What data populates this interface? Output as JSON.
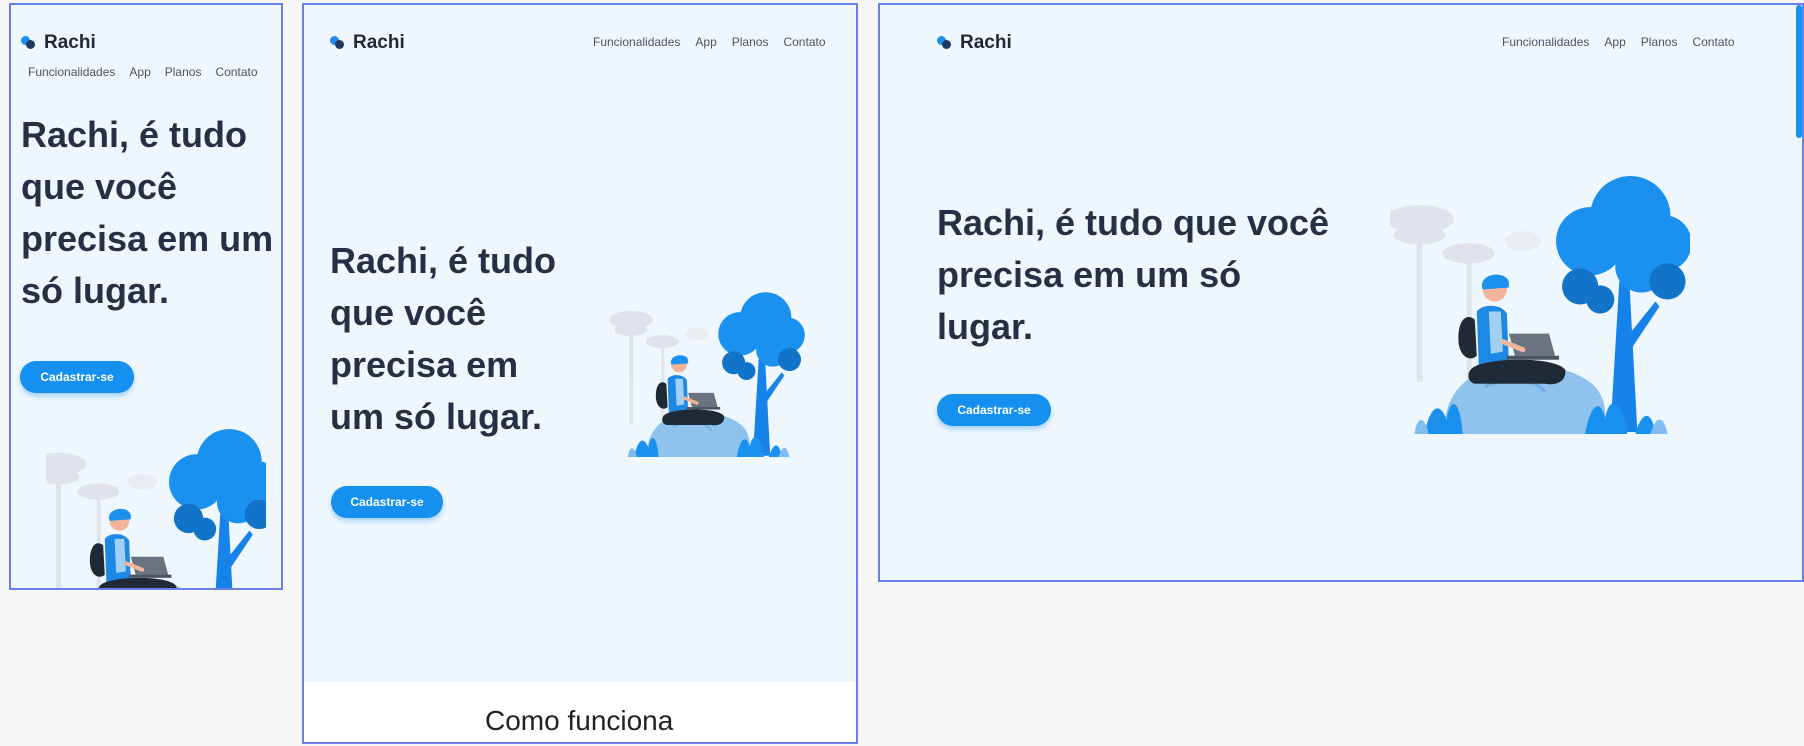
{
  "brand": {
    "name": "Rachi",
    "dot_color": "#1d8ef0",
    "dot_color_dark": "#1f3a5c"
  },
  "nav": {
    "items": [
      "Funcionalidades",
      "App",
      "Planos",
      "Contato"
    ]
  },
  "hero": {
    "title": "Rachi, é tudo que você precisa em um só lugar.",
    "title_lines_mobile": [
      "Rachi, é tudo",
      "que você",
      "precisa em um",
      "só lugar."
    ],
    "title_lines_tablet": [
      "Rachi, é tudo",
      "que você",
      "precisa em",
      "um só lugar."
    ],
    "title_lines_desktop": [
      "Rachi, é tudo que você",
      "precisa em um só",
      "lugar."
    ],
    "cta_label": "Cadastrar-se",
    "illustration": "person-with-laptop-on-rock-under-tree"
  },
  "section_next": {
    "title": "Como funciona"
  },
  "colors": {
    "accent": "#1690ee",
    "background": "#eef6fe",
    "frame_border": "#6b7fe8",
    "heading": "#243144"
  }
}
